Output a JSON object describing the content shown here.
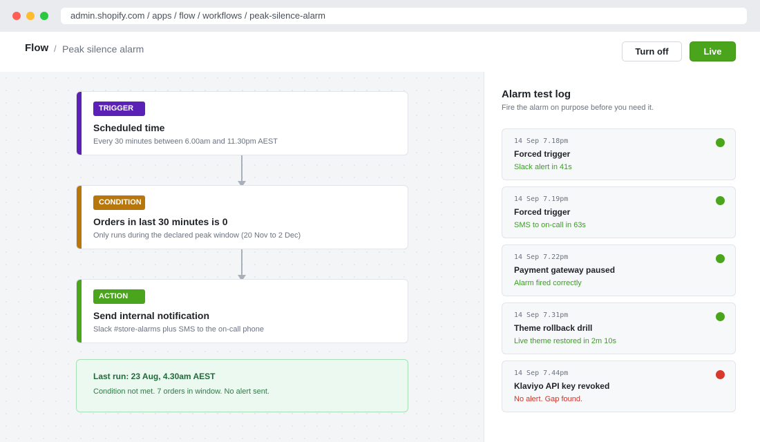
{
  "browser": {
    "url": "admin.shopify.com / apps / flow / workflows / peak-silence-alarm"
  },
  "header": {
    "app_name": "Flow",
    "separator": "/",
    "workflow_name": "Peak silence alarm",
    "turn_off_label": "Turn off",
    "live_label": "Live"
  },
  "workflow": {
    "trigger": {
      "badge": "TRIGGER",
      "title": "Scheduled time",
      "description": "Every 30 minutes between 6.00am and 11.30pm AEST",
      "color": "#5b21b6"
    },
    "condition": {
      "badge": "CONDITION",
      "title": "Orders in last 30 minutes is 0",
      "description": "Only runs during the declared peak window (20 Nov to 2 Dec)",
      "color": "#b7770d"
    },
    "action": {
      "badge": "ACTION",
      "title": "Send internal notification",
      "description": "Slack #store-alarms plus SMS to the on-call phone",
      "color": "#4aa51c"
    },
    "last_run": {
      "title": "Last run: 23 Aug, 4.30am AEST",
      "description": "Condition not met. 7 orders in window. No alert sent."
    }
  },
  "log_panel": {
    "title": "Alarm test log",
    "subtitle": "Fire the alarm on purpose before you need it.",
    "entries": [
      {
        "time": "14 Sep 7.18pm",
        "event": "Forced trigger",
        "result": "Slack alert in 41s",
        "status": "ok"
      },
      {
        "time": "14 Sep 7.19pm",
        "event": "Forced trigger",
        "result": "SMS to on-call in 63s",
        "status": "ok"
      },
      {
        "time": "14 Sep 7.22pm",
        "event": "Payment gateway paused",
        "result": "Alarm fired correctly",
        "status": "ok"
      },
      {
        "time": "14 Sep 7.31pm",
        "event": "Theme rollback drill",
        "result": "Live theme restored in 2m 10s",
        "status": "ok"
      },
      {
        "time": "14 Sep 7.44pm",
        "event": "Klaviyo API key revoked",
        "result": "No alert. Gap found.",
        "status": "fail"
      }
    ]
  },
  "colors": {
    "ok": "#4aa51c",
    "fail": "#d7392c",
    "live_button": "#4aa51c"
  }
}
